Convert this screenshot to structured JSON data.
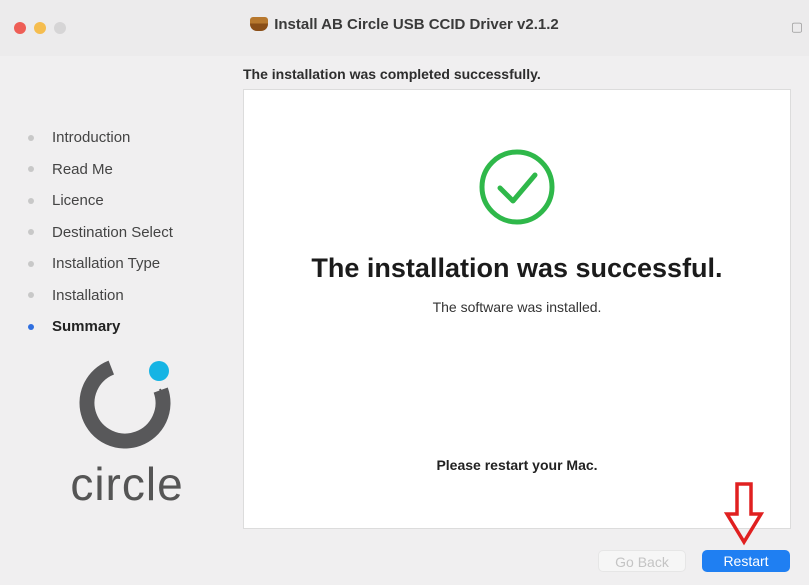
{
  "window": {
    "title": "Install AB Circle USB CCID Driver v2.1.2"
  },
  "heading": "The installation was completed successfully.",
  "steps": [
    {
      "label": "Introduction",
      "active": false
    },
    {
      "label": "Read Me",
      "active": false
    },
    {
      "label": "Licence",
      "active": false
    },
    {
      "label": "Destination Select",
      "active": false
    },
    {
      "label": "Installation Type",
      "active": false
    },
    {
      "label": "Installation",
      "active": false
    },
    {
      "label": "Summary",
      "active": true
    }
  ],
  "logo": {
    "wordmark": "circle"
  },
  "main": {
    "success_title": "The installation was successful.",
    "success_subtitle": "The software was installed.",
    "restart_note": "Please restart your Mac."
  },
  "buttons": {
    "go_back": "Go Back",
    "restart": "Restart"
  },
  "colors": {
    "success_green": "#2fb84a",
    "accent_blue": "#1f7ff2",
    "annotation_red": "#e02020",
    "logo_cyan": "#16b4e4"
  },
  "icons": {
    "window": "package-icon",
    "lock": "lock-icon",
    "success": "checkmark-circle-icon",
    "annotation": "down-arrow-icon"
  }
}
